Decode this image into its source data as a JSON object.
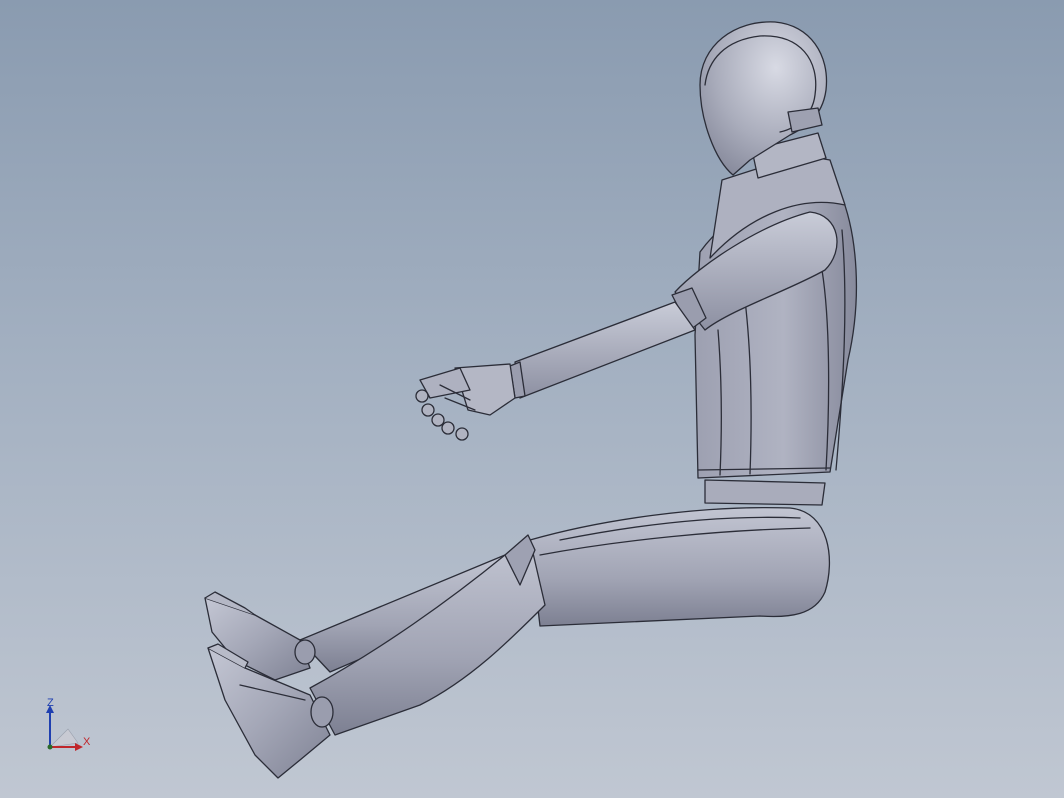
{
  "viewport": {
    "background_top": "#8a9bb0",
    "background_bottom": "#c0c7d2",
    "model_color": "#a3a6b6",
    "edge_color": "#2b2d38"
  },
  "triad": {
    "z_label": "Z",
    "x_label": "X",
    "z_color": "#1f3fb0",
    "x_color": "#c0262b"
  }
}
